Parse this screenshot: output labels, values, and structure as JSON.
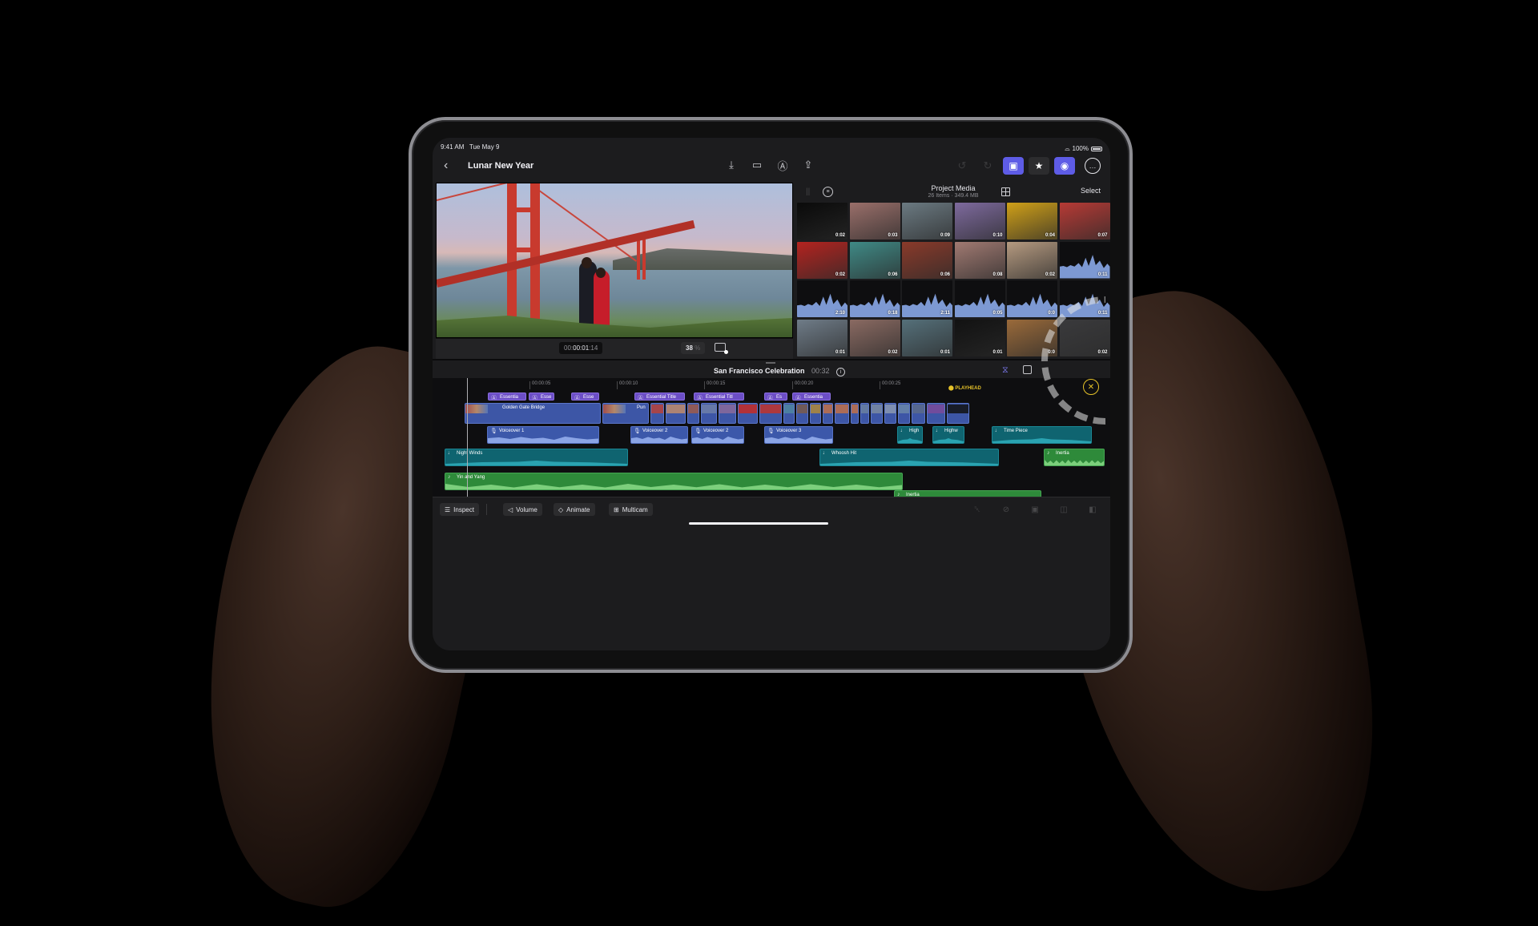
{
  "status_bar": {
    "time": "9:41 AM",
    "date": "Tue May 9",
    "battery": "100%"
  },
  "top_bar": {
    "back_icon": "chevron-left-icon",
    "project_title": "Lunar New Year",
    "icons": [
      "import-icon",
      "camera-icon",
      "voiceover-icon",
      "share-icon"
    ],
    "right_icons": [
      "undo-icon",
      "redo-icon",
      "photos-browser-icon",
      "effects-icon",
      "inspector-icon",
      "more-icon"
    ]
  },
  "viewer": {
    "timecode_prefix": "00:",
    "timecode_main": "00:01",
    "timecode_frames": ":14",
    "zoom_value": "38",
    "zoom_unit": "%"
  },
  "browser": {
    "title": "Project Media",
    "subtitle": "26 Items  ·  349.4 MB",
    "select_label": "Select",
    "tiles": [
      {
        "type": "video",
        "duration": "0:02",
        "color": "#0a0a0a"
      },
      {
        "type": "video",
        "duration": "0:03",
        "color": "#9a6f6a"
      },
      {
        "type": "video",
        "duration": "0:09",
        "color": "#6b7a82"
      },
      {
        "type": "video",
        "duration": "0:10",
        "color": "#7e6a9e"
      },
      {
        "type": "video",
        "duration": "0:04",
        "color": "#d0a018"
      },
      {
        "type": "video",
        "duration": "0:07",
        "color": "#b73a35"
      },
      {
        "type": "video",
        "duration": "0:02",
        "color": "#b4231f"
      },
      {
        "type": "video",
        "duration": "0:06",
        "color": "#3f8a86"
      },
      {
        "type": "video",
        "duration": "0:06",
        "color": "#8a3a2a"
      },
      {
        "type": "video",
        "duration": "0:08",
        "color": "#a17a72"
      },
      {
        "type": "video",
        "duration": "0:02",
        "color": "#b59a80"
      },
      {
        "type": "audio",
        "duration": "0:11"
      },
      {
        "type": "audio",
        "duration": "2:10"
      },
      {
        "type": "audio",
        "duration": "0:18"
      },
      {
        "type": "audio",
        "duration": "2:11"
      },
      {
        "type": "audio",
        "duration": "0:05"
      },
      {
        "type": "audio",
        "duration": "0:0"
      },
      {
        "type": "audio",
        "duration": "0:11"
      },
      {
        "type": "video",
        "duration": "0:01",
        "color": "#6f7c88"
      },
      {
        "type": "video",
        "duration": "0:02",
        "color": "#8a6a62"
      },
      {
        "type": "video",
        "duration": "0:01",
        "color": "#55707a"
      },
      {
        "type": "video",
        "duration": "0:01",
        "color": "#121212"
      },
      {
        "type": "video",
        "duration": "0:0",
        "color": "#9a6a3a"
      },
      {
        "type": "video",
        "duration": "0:02",
        "color": "#3a3a3c"
      }
    ],
    "playhead_label": "PLAYHEAD"
  },
  "timeline": {
    "project_name": "San Francisco Celebration",
    "project_duration": "00:32",
    "ruler": [
      "00:00:05",
      "00:00:10",
      "00:00:15",
      "00:00:20",
      "00:00:25"
    ],
    "titles": [
      {
        "label": "Essentia"
      },
      {
        "label": "Esse"
      },
      {
        "label": "Esse"
      },
      {
        "label": "Essential Title"
      },
      {
        "label": "Essential Titl"
      },
      {
        "label": "Es"
      },
      {
        "label": "Essentia"
      }
    ],
    "video_main": {
      "label": "Golden Gate Bridge"
    },
    "video_second": {
      "label": "Pun"
    },
    "voiceovers": [
      {
        "label": "Voiceover 1"
      },
      {
        "label": "Voiceover 2"
      },
      {
        "label": "Voiceover 2"
      },
      {
        "label": "Voiceover 3"
      }
    ],
    "sfx": [
      {
        "label": "High"
      },
      {
        "label": "Highw"
      },
      {
        "label": "Time Piece"
      },
      {
        "label": "Night Winds"
      },
      {
        "label": "Whoosh Hit"
      }
    ],
    "music": [
      {
        "label": "Inertia"
      },
      {
        "label": "Yin and Yang"
      },
      {
        "label": "Inertia"
      }
    ]
  },
  "bottom_bar": {
    "inspect": "Inspect",
    "volume": "Volume",
    "animate": "Animate",
    "multicam": "Multicam",
    "right_icons": [
      "delete-icon",
      "enable-icon",
      "detach-icon",
      "split-icon",
      "replace-icon"
    ]
  }
}
